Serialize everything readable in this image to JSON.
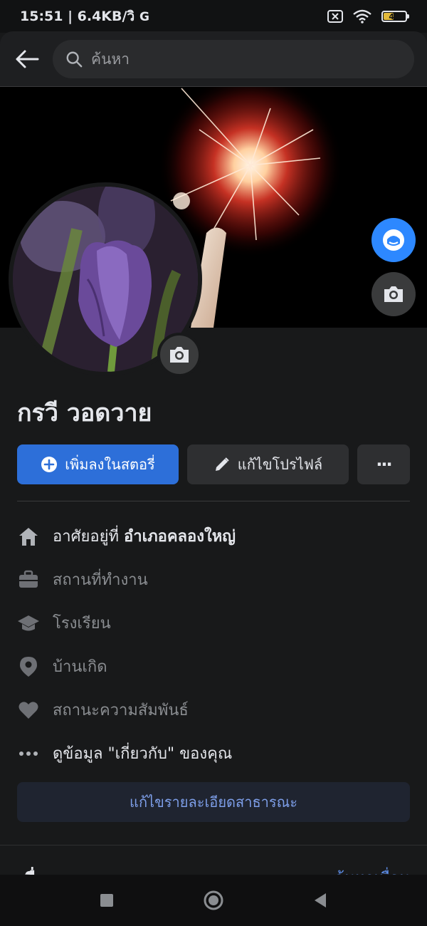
{
  "status": {
    "time_speed": "15:51 | 6.4KB/วิ",
    "carrier_icon": "google-g-icon",
    "battery": "47",
    "battery_color": "#e2b93b"
  },
  "search": {
    "placeholder": "ค้นหา"
  },
  "profile": {
    "name": "กรวี วอดวาย"
  },
  "actions": {
    "add_story": "เพิ่มลงในสตอรี่",
    "edit_profile": "แก้ไขโปรไฟล์",
    "more": "···"
  },
  "details": {
    "lives_in_prefix": "อาศัยอยู่ที่ ",
    "lives_in_place": "อำเภอคลองใหญ่",
    "workplace": "สถานที่ทำงาน",
    "school": "โรงเรียน",
    "hometown": "บ้านเกิด",
    "relationship": "สถานะความสัมพันธ์",
    "about": "ดูข้อมูล \"เกี่ยวกับ\" ของคุณ"
  },
  "edit_public_details": "แก้ไขรายละเอียดสาธารณะ",
  "friends": {
    "title": "เพื่อน",
    "find_link": "ค้นหาเพื่อน"
  },
  "colors": {
    "accent": "#2d6fd9",
    "link": "#7d9ee8"
  }
}
